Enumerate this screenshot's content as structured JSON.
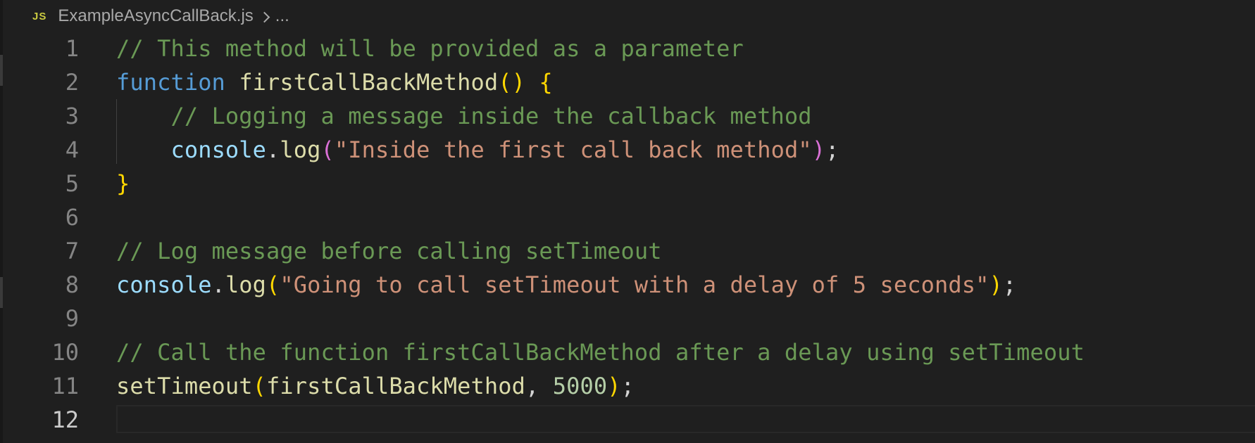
{
  "breadcrumb": {
    "language_badge": "JS",
    "file_name": "ExampleAsyncCallBack.js",
    "more": "..."
  },
  "editor": {
    "active_line": 12,
    "lines": [
      {
        "number": "1",
        "tokens": [
          {
            "t": "// This method will be provided as a parameter",
            "c": "c"
          }
        ]
      },
      {
        "number": "2",
        "tokens": [
          {
            "t": "function",
            "c": "k"
          },
          {
            "t": " ",
            "c": "p"
          },
          {
            "t": "firstCallBackMethod",
            "c": "f"
          },
          {
            "t": "()",
            "c": "b1"
          },
          {
            "t": " ",
            "c": "p"
          },
          {
            "t": "{",
            "c": "b1"
          }
        ]
      },
      {
        "number": "3",
        "tokens": [
          {
            "t": "    ",
            "c": "p"
          },
          {
            "t": "// Logging a message inside the callback method",
            "c": "c"
          }
        ]
      },
      {
        "number": "4",
        "tokens": [
          {
            "t": "    ",
            "c": "p"
          },
          {
            "t": "console",
            "c": "v"
          },
          {
            "t": ".",
            "c": "p"
          },
          {
            "t": "log",
            "c": "f"
          },
          {
            "t": "(",
            "c": "b2"
          },
          {
            "t": "\"Inside the first call back method\"",
            "c": "s"
          },
          {
            "t": ")",
            "c": "b2"
          },
          {
            "t": ";",
            "c": "p"
          }
        ]
      },
      {
        "number": "5",
        "tokens": [
          {
            "t": "}",
            "c": "b1"
          }
        ]
      },
      {
        "number": "6",
        "tokens": []
      },
      {
        "number": "7",
        "tokens": [
          {
            "t": "// Log message before calling setTimeout",
            "c": "c"
          }
        ]
      },
      {
        "number": "8",
        "tokens": [
          {
            "t": "console",
            "c": "v"
          },
          {
            "t": ".",
            "c": "p"
          },
          {
            "t": "log",
            "c": "f"
          },
          {
            "t": "(",
            "c": "b1"
          },
          {
            "t": "\"Going to call setTimeout with a delay of 5 seconds\"",
            "c": "s"
          },
          {
            "t": ")",
            "c": "b1"
          },
          {
            "t": ";",
            "c": "p"
          }
        ]
      },
      {
        "number": "9",
        "tokens": []
      },
      {
        "number": "10",
        "tokens": [
          {
            "t": "// Call the function firstCallBackMethod after a delay using setTimeout",
            "c": "c"
          }
        ]
      },
      {
        "number": "11",
        "tokens": [
          {
            "t": "setTimeout",
            "c": "f"
          },
          {
            "t": "(",
            "c": "b1"
          },
          {
            "t": "firstCallBackMethod",
            "c": "f"
          },
          {
            "t": ", ",
            "c": "p"
          },
          {
            "t": "5000",
            "c": "n"
          },
          {
            "t": ")",
            "c": "b1"
          },
          {
            "t": ";",
            "c": "p"
          }
        ]
      },
      {
        "number": "12",
        "tokens": []
      }
    ]
  },
  "colors": {
    "background": "#1f1f1f",
    "comment": "#6a9955",
    "keyword": "#569cd6",
    "function": "#dcdcaa",
    "variable": "#9cdcfe",
    "string": "#ce9178",
    "number": "#b5cea8",
    "bracket_level1": "#ffd700",
    "bracket_level2": "#da70d6"
  }
}
